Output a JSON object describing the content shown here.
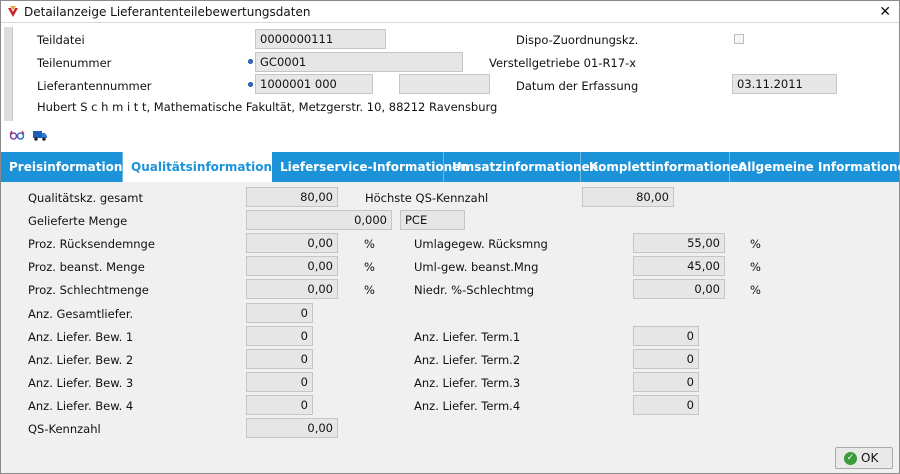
{
  "window": {
    "title": "Detailanzeige Lieferantenteilebewertungsdaten",
    "close_label": "✕"
  },
  "header": {
    "teildatei_label": "Teildatei",
    "teildatei_value": "0000000111",
    "teilenummer_label": "Teilenummer",
    "teilenummer_value": "GC0001",
    "lieferantennummer_label": "Lieferantennummer",
    "lieferantennummer_value": "1000001 000",
    "lieferantennummer_extra": "",
    "address": "Hubert S c h m i t t, Mathematische Fakultät, Metzgerstr. 10, 88212 Ravensburg",
    "dispo_label": "Dispo-Zuordnungskz.",
    "verstellgetriebe": "Verstellgetriebe 01-R17-x",
    "datum_label": "Datum der Erfassung",
    "datum_value": "03.11.2011"
  },
  "tabs": [
    "Preisinformationen",
    "Qualitätsinformationen",
    "Lieferservice-Informationen",
    "Umsatzinformationen",
    "Komplettinformationen",
    "Allgemeine Informationen"
  ],
  "content": {
    "qkz_label": "Qualitätskz. gesamt",
    "qkz_value": "80,00",
    "hoechste_label": "Höchste QS-Kennzahl",
    "hoechste_value": "80,00",
    "geliefert_label": "Gelieferte Menge",
    "geliefert_value": "0,000",
    "unit": "PCE",
    "rueck_label": "Proz. Rücksendemnge",
    "rueck_value": "0,00",
    "beanst_label": "Proz. beanst. Menge",
    "beanst_value": "0,00",
    "schlecht_label": "Proz. Schlechtmenge",
    "schlecht_value": "0,00",
    "pct_sign": "%",
    "umlage_rueck_label": "Umlagegew. Rücksmng",
    "umlage_rueck_value": "55,00",
    "umlage_beanst_label": "Uml-gew. beanst.Mng",
    "umlage_beanst_value": "45,00",
    "niedr_label": "Niedr. %-Schlechtmg",
    "niedr_value": "0,00",
    "gesamt_label": "Anz. Gesamtliefer.",
    "gesamt_value": "0",
    "bew1_label": "Anz. Liefer. Bew. 1",
    "bew1_value": "0",
    "bew2_label": "Anz. Liefer. Bew. 2",
    "bew2_value": "0",
    "bew3_label": "Anz. Liefer. Bew. 3",
    "bew3_value": "0",
    "bew4_label": "Anz. Liefer. Bew. 4",
    "bew4_value": "0",
    "term1_label": "Anz. Liefer. Term.1",
    "term1_value": "0",
    "term2_label": "Anz. Liefer. Term.2",
    "term2_value": "0",
    "term3_label": "Anz. Liefer. Term.3",
    "term3_value": "0",
    "term4_label": "Anz. Liefer. Term.4",
    "term4_value": "0",
    "qs_label": "QS-Kennzahl",
    "qs_value": "0,00"
  },
  "footer": {
    "ok_label": "OK"
  },
  "colors": {
    "tab_bar": "#1c93d8",
    "field_bg": "#e6e6e6",
    "ok_icon": "#3a9c3a"
  }
}
